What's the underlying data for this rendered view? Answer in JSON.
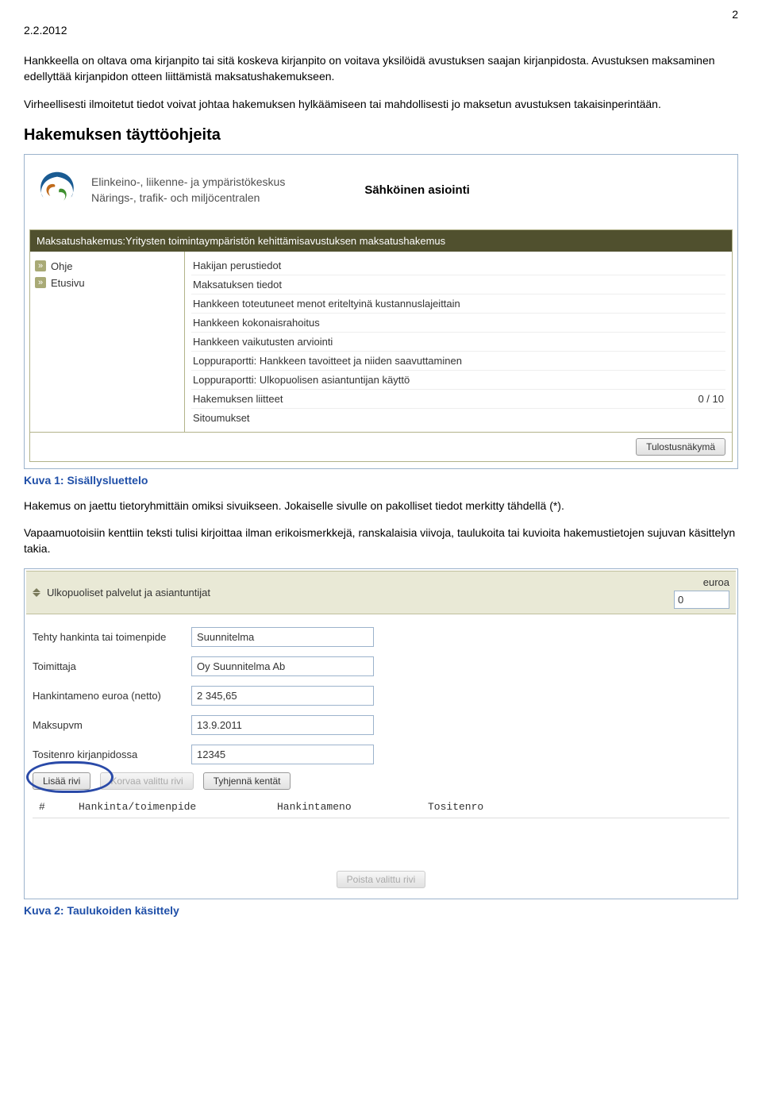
{
  "page_number": "2",
  "date": "2.2.2012",
  "intro_para_1": "Hankkeella on oltava oma kirjanpito tai sitä koskeva kirjanpito on voitava yksilöidä avustuksen saajan kirjanpidosta. Avustuksen maksaminen edellyttää kirjanpidon otteen liittämistä maksatushakemukseen.",
  "intro_para_2": "Virheellisesti ilmoitetut tiedot voivat johtaa hakemuksen hylkäämiseen tai mahdollisesti jo maksetun avustuksen takaisinperintään.",
  "section_heading": "Hakemuksen täyttöohjeita",
  "fig1": {
    "logo_line1": "Elinkeino-, liikenne- ja ympäristökeskus",
    "logo_line2": "Närings-, trafik- och miljöcentralen",
    "right_title": "Sähköinen asiointi",
    "titlebar": "Maksatushakemus:Yritysten toimintaympäristön kehittämisavustuksen maksatushakemus",
    "sidebar": [
      {
        "label": "Ohje"
      },
      {
        "label": "Etusivu"
      }
    ],
    "items": [
      {
        "label": "Hakijan perustiedot",
        "count": ""
      },
      {
        "label": "Maksatuksen tiedot",
        "count": ""
      },
      {
        "label": "Hankkeen toteutuneet menot eriteltyinä kustannuslajeittain",
        "count": ""
      },
      {
        "label": "Hankkeen kokonaisrahoitus",
        "count": ""
      },
      {
        "label": "Hankkeen vaikutusten arviointi",
        "count": ""
      },
      {
        "label": "Loppuraportti: Hankkeen tavoitteet ja niiden saavuttaminen",
        "count": ""
      },
      {
        "label": "Loppuraportti: Ulkopuolisen asiantuntijan käyttö",
        "count": ""
      },
      {
        "label": "Hakemuksen liitteet",
        "count": "0 / 10"
      },
      {
        "label": "Sitoumukset",
        "count": ""
      }
    ],
    "print_button": "Tulostusnäkymä"
  },
  "caption1": "Kuva 1: Sisällysluettelo",
  "para_after_fig1_a": "Hakemus on jaettu tietoryhmittäin omiksi sivuikseen. Jokaiselle sivulle on pakolliset tiedot merkitty tähdellä (*).",
  "para_after_fig1_b": "Vapaamuotoisiin kenttiin teksti tulisi kirjoittaa ilman erikoismerkkejä, ranskalaisia viivoja, taulukoita tai kuvioita hakemustietojen sujuvan käsittelyn takia.",
  "fig2": {
    "section_title": "Ulkopuoliset palvelut ja asiantuntijat",
    "euroa_label": "euroa",
    "euroa_value": "0",
    "rows": [
      {
        "label": "Tehty hankinta tai toimenpide",
        "value": "Suunnitelma"
      },
      {
        "label": "Toimittaja",
        "value": "Oy Suunnitelma Ab"
      },
      {
        "label": "Hankintameno euroa (netto)",
        "value": "2 345,65"
      },
      {
        "label": "Maksupvm",
        "value": "13.9.2011"
      },
      {
        "label": "Tositenro kirjanpidossa",
        "value": "12345"
      }
    ],
    "btn_add": "Lisää rivi",
    "btn_replace": "Korvaa valittu rivi",
    "btn_clear": "Tyhjennä kentät",
    "cols": [
      "#",
      "Hankinta/toimenpide",
      "Hankintameno",
      "Tositenro"
    ],
    "btn_delete": "Poista valittu rivi"
  },
  "caption2": "Kuva 2: Taulukoiden käsittely"
}
